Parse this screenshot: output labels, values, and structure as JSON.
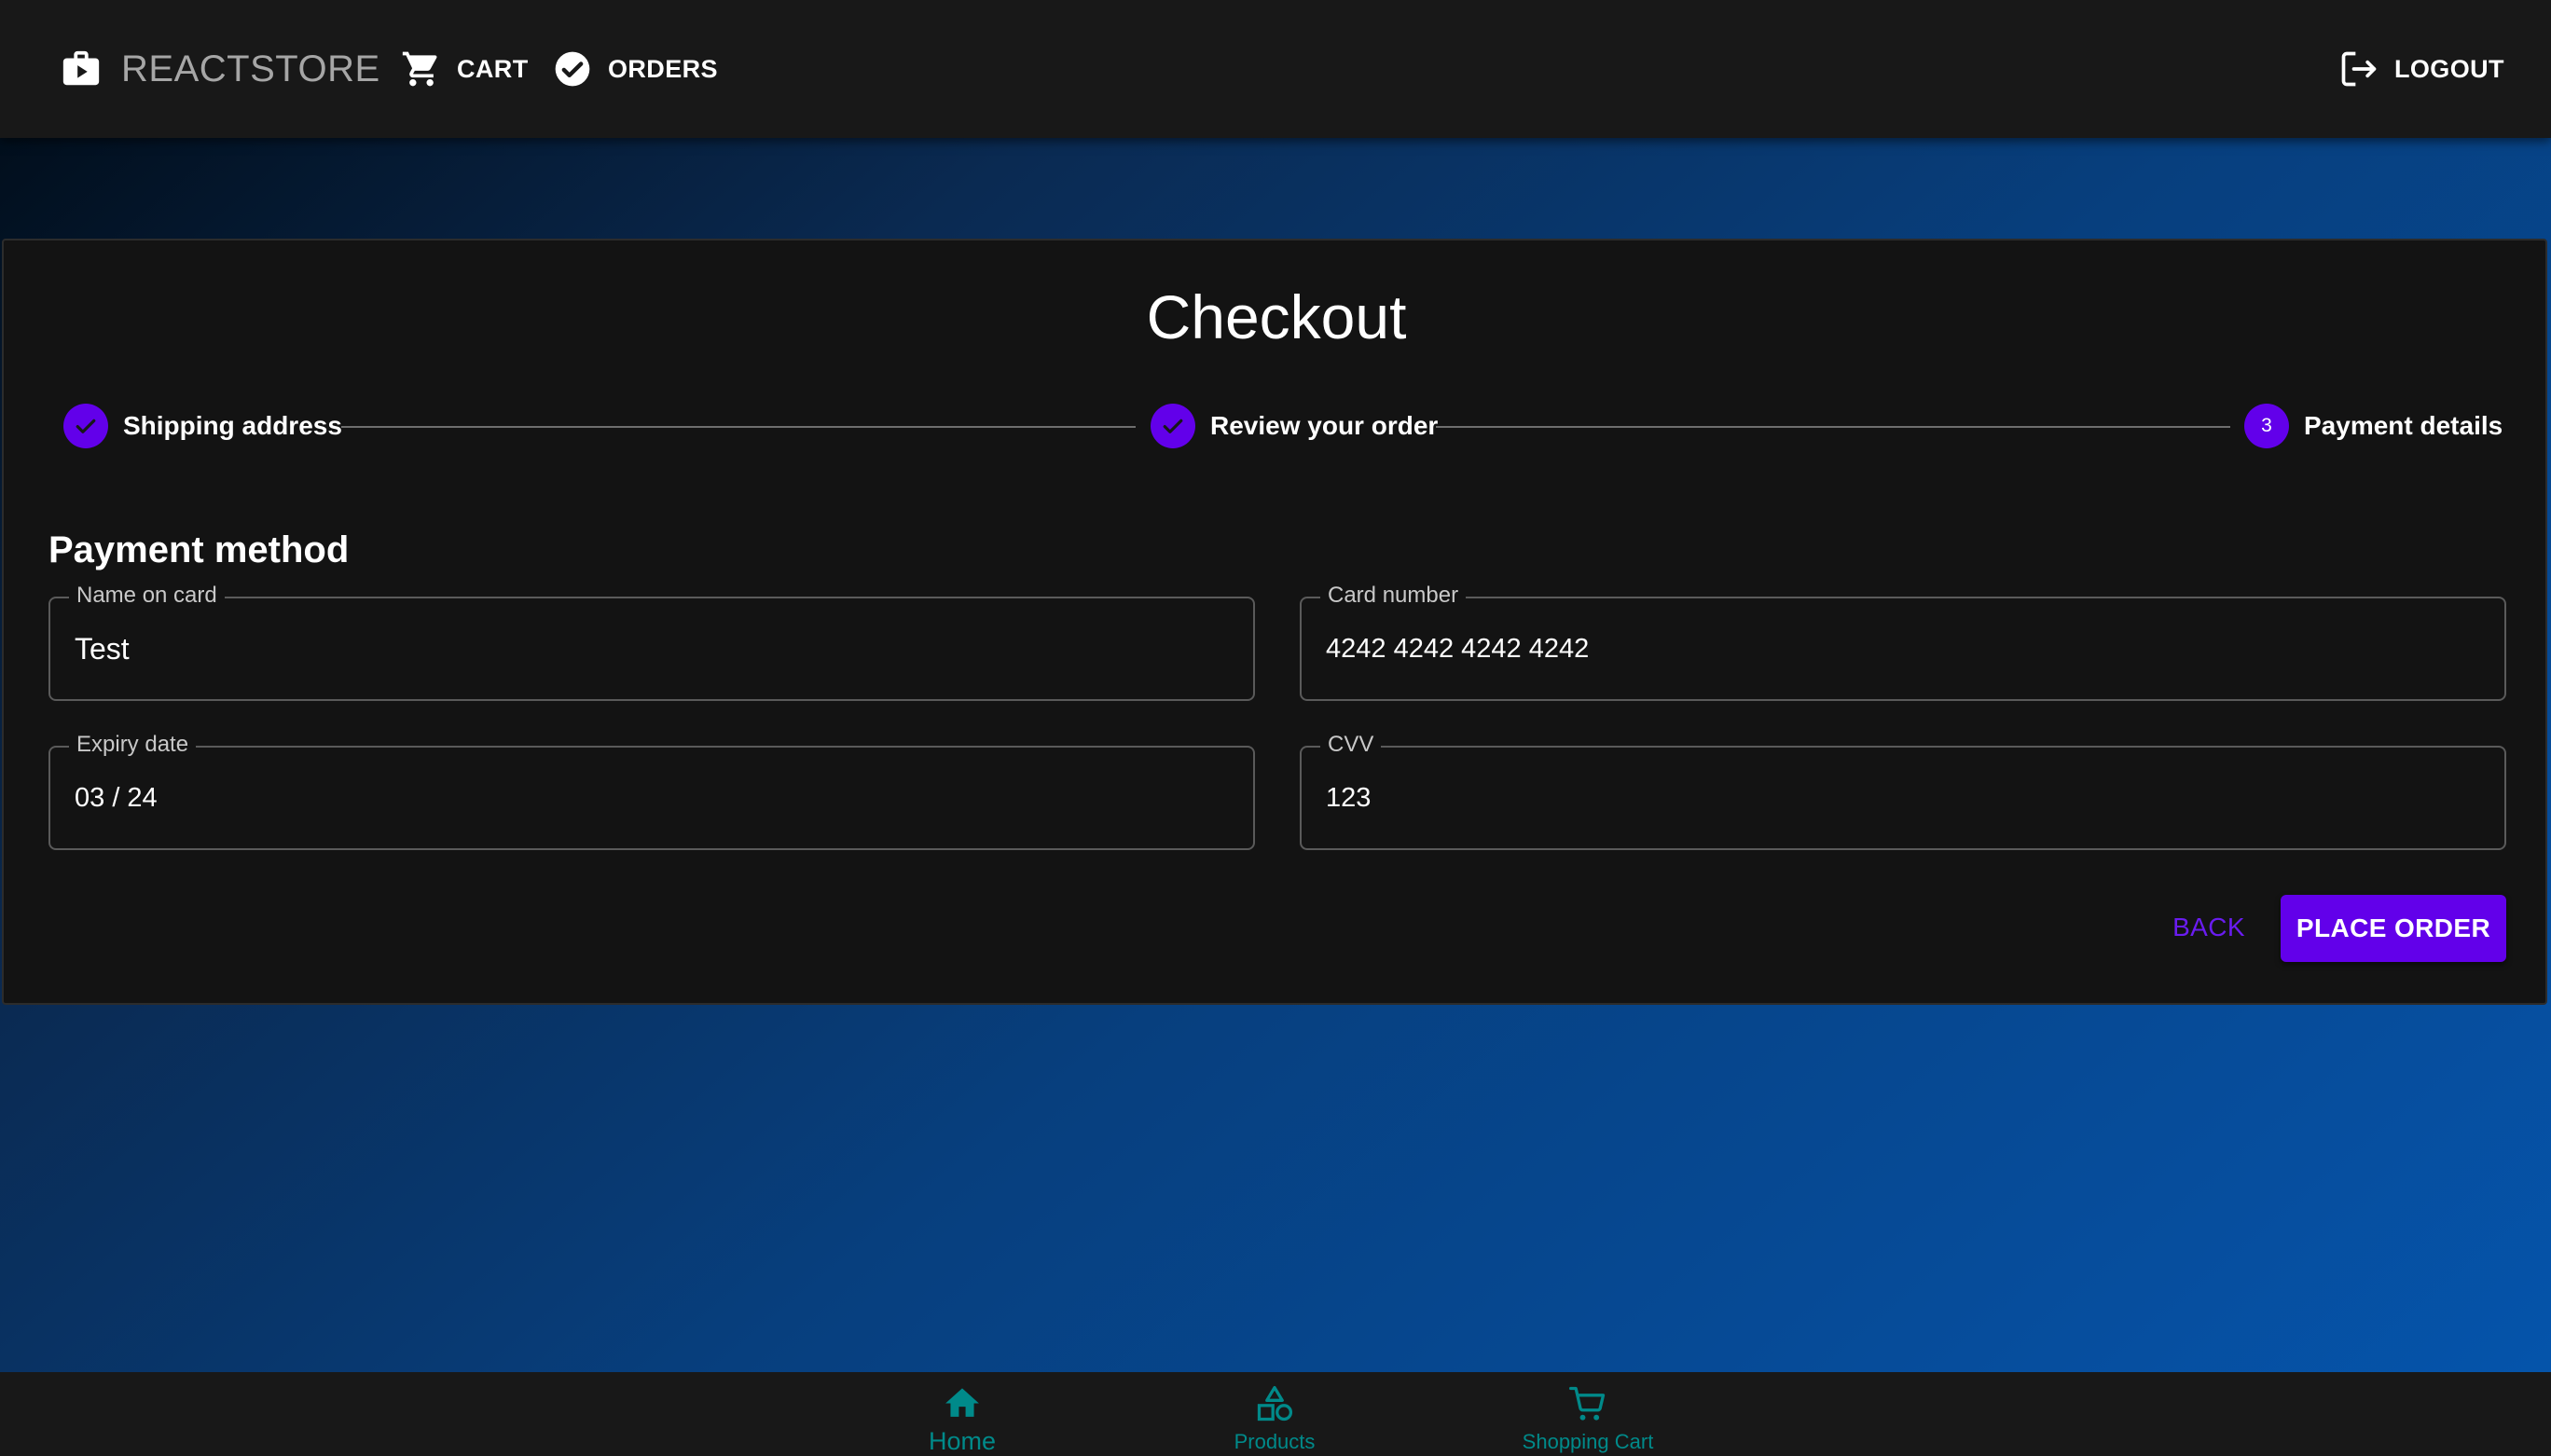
{
  "header": {
    "brand": "REACTSTORE",
    "nav": {
      "cart": "CART",
      "orders": "ORDERS",
      "logout": "LOGOUT"
    }
  },
  "checkout": {
    "title": "Checkout",
    "steps": [
      {
        "label": "Shipping address",
        "status": "completed",
        "icon": "check-icon"
      },
      {
        "label": "Review your order",
        "status": "completed",
        "icon": "check-icon"
      },
      {
        "label": "Payment details",
        "status": "active",
        "number": "3"
      }
    ],
    "section_title": "Payment method",
    "fields": {
      "name_on_card": {
        "label": "Name on card",
        "value": "Test"
      },
      "card_number": {
        "label": "Card number",
        "value": "4242 4242 4242 4242"
      },
      "expiry_date": {
        "label": "Expiry date",
        "value": "03 / 24"
      },
      "cvv": {
        "label": "CVV",
        "value": "123"
      }
    },
    "actions": {
      "back": "BACK",
      "place_order": "PLACE ORDER"
    }
  },
  "bottom_nav": {
    "items": [
      {
        "label": "Home",
        "icon": "home-icon",
        "selected": true
      },
      {
        "label": "Products",
        "icon": "shapes-icon"
      },
      {
        "label": "Shopping Cart",
        "icon": "shopping-cart-icon"
      }
    ]
  },
  "colors": {
    "accent": "#6200ea",
    "bottom_nav": "#008a8a",
    "app_bar": "#181818",
    "surface": "#131313"
  }
}
